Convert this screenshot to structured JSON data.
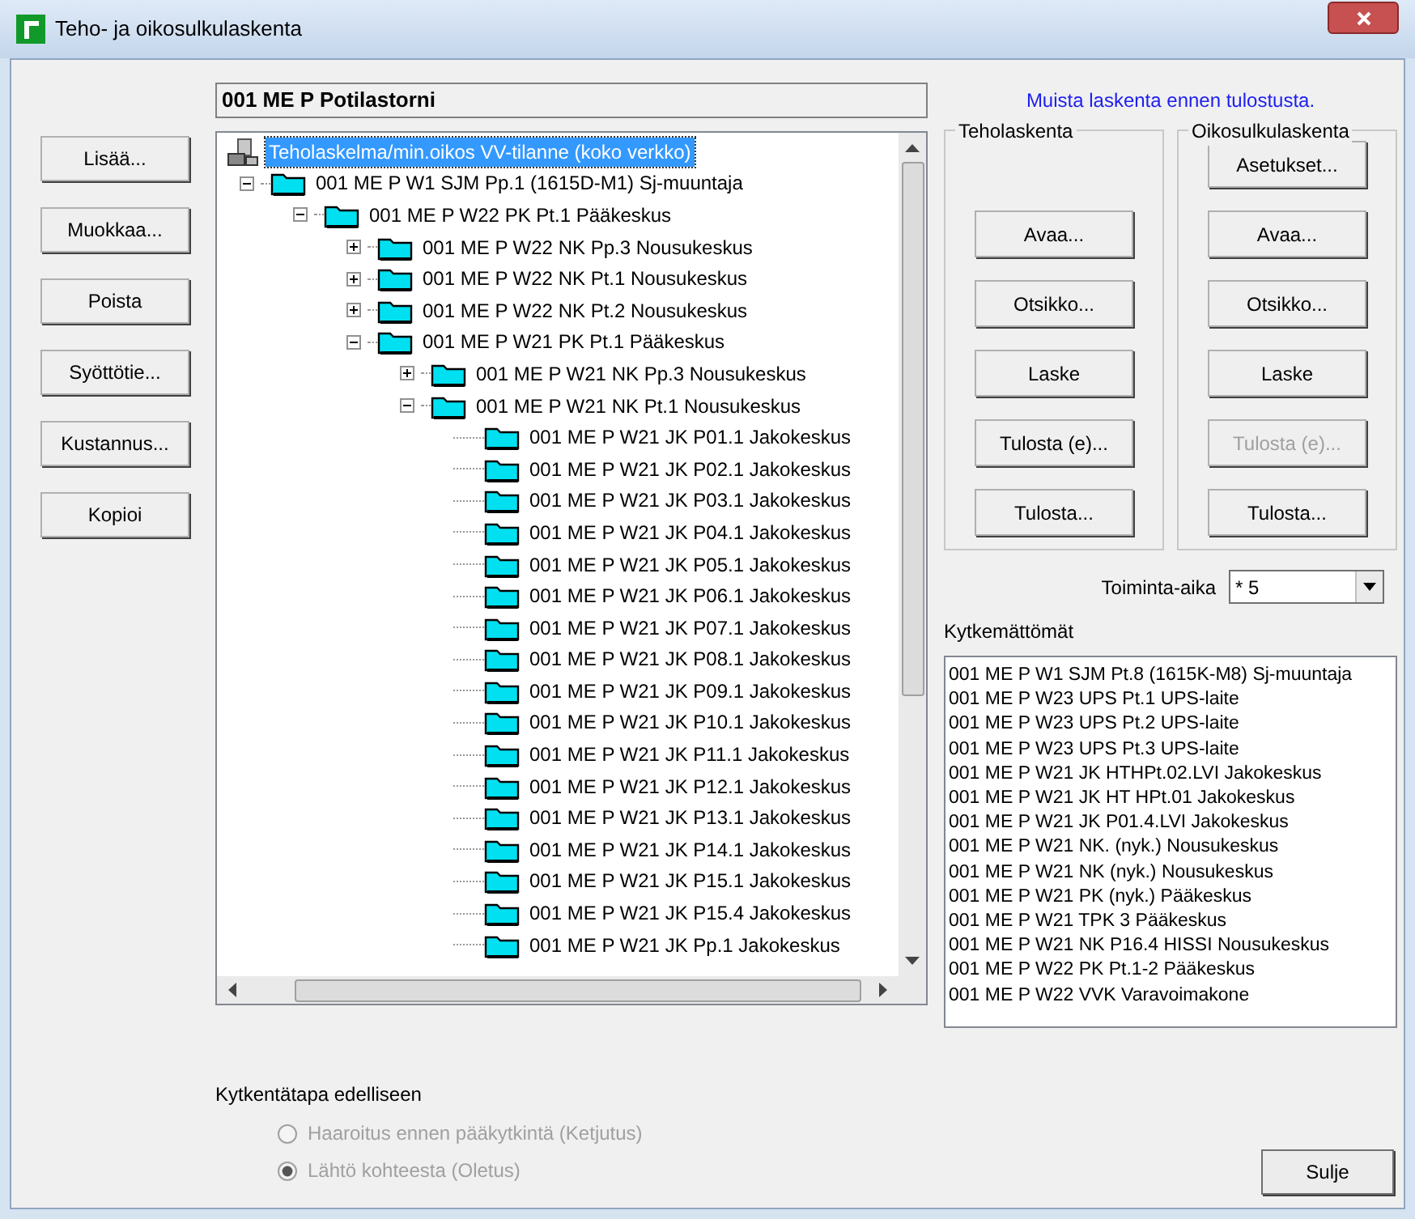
{
  "window": {
    "title": "Teho- ja oikosulkulaskenta"
  },
  "header": {
    "value": "001 ME P Potilastorni"
  },
  "left_buttons": [
    "Lisää...",
    "Muokkaa...",
    "Poista",
    "Syöttötie...",
    "Kustannus...",
    "Kopioi"
  ],
  "tree": {
    "items": [
      {
        "label": "Teholaskelma/min.oikos VV-tilanne (koko verkko)",
        "kind": "root",
        "selected": true,
        "children": [
          {
            "label": "001 ME P W1 SJM Pp.1 (1615D-M1) Sj-muuntaja",
            "kind": "folder",
            "selected": false,
            "expanded": true,
            "children": [
              {
                "label": "001 ME P W22 PK Pt.1 Pääkeskus",
                "kind": "folder",
                "selected": false,
                "expanded": true,
                "children": [
                  {
                    "label": "001 ME P W22 NK Pp.3 Nousukeskus",
                    "kind": "folder",
                    "selected": false,
                    "expanded": false
                  },
                  {
                    "label": "001 ME P W22 NK Pt.1 Nousukeskus",
                    "kind": "folder",
                    "selected": false,
                    "expanded": false
                  },
                  {
                    "label": "001 ME P W22 NK Pt.2 Nousukeskus",
                    "kind": "folder",
                    "selected": false,
                    "expanded": false
                  },
                  {
                    "label": "001 ME P W21 PK Pt.1 Pääkeskus",
                    "kind": "folder",
                    "selected": false,
                    "expanded": true,
                    "children": [
                      {
                        "label": "001 ME P W21 NK Pp.3 Nousukeskus",
                        "kind": "folder",
                        "selected": false,
                        "expanded": false
                      },
                      {
                        "label": "001 ME P W21 NK Pt.1 Nousukeskus",
                        "kind": "folder",
                        "selected": false,
                        "expanded": true,
                        "children": [
                          {
                            "label": "001 ME P W21 JK P01.1 Jakokeskus",
                            "kind": "leaf",
                            "selected": false
                          },
                          {
                            "label": "001 ME P W21 JK P02.1 Jakokeskus",
                            "kind": "leaf",
                            "selected": false
                          },
                          {
                            "label": "001 ME P W21 JK P03.1 Jakokeskus",
                            "kind": "leaf",
                            "selected": false
                          },
                          {
                            "label": "001 ME P W21 JK P04.1 Jakokeskus",
                            "kind": "leaf",
                            "selected": false
                          },
                          {
                            "label": "001 ME P W21 JK P05.1 Jakokeskus",
                            "kind": "leaf",
                            "selected": false
                          },
                          {
                            "label": "001 ME P W21 JK P06.1 Jakokeskus",
                            "kind": "leaf",
                            "selected": false
                          },
                          {
                            "label": "001 ME P W21 JK P07.1 Jakokeskus",
                            "kind": "leaf",
                            "selected": false
                          },
                          {
                            "label": "001 ME P W21 JK P08.1 Jakokeskus",
                            "kind": "leaf",
                            "selected": false
                          },
                          {
                            "label": "001 ME P W21 JK P09.1 Jakokeskus",
                            "kind": "leaf",
                            "selected": false
                          },
                          {
                            "label": "001 ME P W21 JK P10.1 Jakokeskus",
                            "kind": "leaf",
                            "selected": false
                          },
                          {
                            "label": "001 ME P W21 JK P11.1 Jakokeskus",
                            "kind": "leaf",
                            "selected": false
                          },
                          {
                            "label": "001 ME P W21 JK P12.1 Jakokeskus",
                            "kind": "leaf",
                            "selected": false
                          },
                          {
                            "label": "001 ME P W21 JK P13.1 Jakokeskus",
                            "kind": "leaf",
                            "selected": false
                          },
                          {
                            "label": "001 ME P W21 JK P14.1 Jakokeskus",
                            "kind": "leaf",
                            "selected": false
                          },
                          {
                            "label": "001 ME P W21 JK P15.1 Jakokeskus",
                            "kind": "leaf",
                            "selected": false
                          },
                          {
                            "label": "001 ME P W21 JK P15.4 Jakokeskus",
                            "kind": "leaf",
                            "selected": false
                          },
                          {
                            "label": "001 ME P W21 JK Pp.1 Jakokeskus",
                            "kind": "leaf",
                            "selected": false
                          }
                        ]
                      }
                    ]
                  }
                ]
              }
            ]
          }
        ]
      }
    ]
  },
  "notice": "Muista laskenta ennen tulostusta.",
  "groups": [
    {
      "title": "Teholaskenta",
      "buttons": [
        {
          "label": "Avaa...",
          "disabled": false
        },
        {
          "label": "Otsikko...",
          "disabled": false
        },
        {
          "label": "Laske",
          "disabled": false
        },
        {
          "label": "Tulosta (e)...",
          "disabled": false
        },
        {
          "label": "Tulosta...",
          "disabled": false
        }
      ]
    },
    {
      "title": "Oikosulkulaskenta",
      "buttons": [
        {
          "label": "Asetukset...",
          "disabled": false
        },
        {
          "label": "Avaa...",
          "disabled": false
        },
        {
          "label": "Otsikko...",
          "disabled": false
        },
        {
          "label": "Laske",
          "disabled": false
        },
        {
          "label": "Tulosta (e)...",
          "disabled": true
        },
        {
          "label": "Tulosta...",
          "disabled": false
        }
      ]
    }
  ],
  "operating_time": {
    "label": "Toiminta-aika",
    "value": "* 5"
  },
  "unconnected": {
    "label": "Kytkemättömät",
    "items": [
      "001 ME P W1 SJM Pt.8 (1615K-M8) Sj-muuntaja",
      "001 ME P W23 UPS Pt.1 UPS-laite",
      "001 ME P W23 UPS Pt.2 UPS-laite",
      "001 ME P W23 UPS Pt.3 UPS-laite",
      "001 ME P W21 JK HTHPt.02.LVI Jakokeskus",
      "001 ME P W21 JK HT HPt.01 Jakokeskus",
      "001 ME P W21 JK P01.4.LVI Jakokeskus",
      "001 ME P W21 NK. (nyk.) Nousukeskus",
      "001 ME P W21 NK (nyk.) Nousukeskus",
      "001 ME P W21 PK (nyk.) Pääkeskus",
      "001 ME P W21 TPK 3 Pääkeskus",
      "001 ME P W21 NK P16.4 HISSI Nousukeskus",
      "001 ME P W22 PK Pt.1-2 Pääkeskus",
      "001 ME P W22 VVK Varavoimakone"
    ]
  },
  "connection": {
    "label": "Kytkentätapa edelliseen",
    "options": [
      {
        "label": "Haaroitus ennen pääkytkintä (Ketjutus)",
        "selected": false,
        "disabled": true
      },
      {
        "label": "Lähtö kohteesta (Oletus)",
        "selected": true,
        "disabled": true
      }
    ]
  },
  "close_button": "Sulje"
}
